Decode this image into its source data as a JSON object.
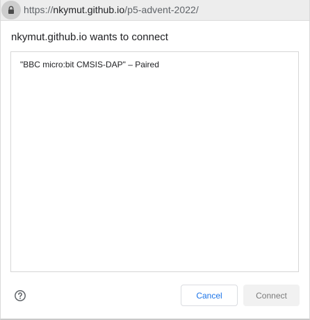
{
  "address_bar": {
    "scheme": "https://",
    "host": "nkymut.github.io",
    "path": "/p5-advent-2022/",
    "icon": "lock-icon"
  },
  "dialog": {
    "title": "nkymut.github.io wants to connect",
    "devices": [
      {
        "label": "\"BBC micro:bit CMSIS-DAP\" – Paired"
      }
    ],
    "help_icon": "help-circle-icon",
    "cancel_label": "Cancel",
    "connect_label": "Connect"
  },
  "colors": {
    "accent": "#1a73e8",
    "disabled_text": "#7a7a7a",
    "disabled_bg": "#f1f1f1",
    "urlbar_bg": "#ededed"
  }
}
